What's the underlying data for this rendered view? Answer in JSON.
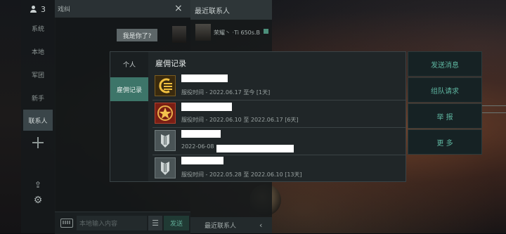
{
  "sidebar": {
    "online_count": "3",
    "items": [
      {
        "label": "系统"
      },
      {
        "label": "本地"
      },
      {
        "label": "军团"
      },
      {
        "label": "新手"
      },
      {
        "label": "联系人"
      }
    ]
  },
  "chat": {
    "title": "戏纠",
    "close_icon": "×",
    "message": "我是你了?",
    "input_placeholder": "本地输入内容",
    "send_label": "发送"
  },
  "recent_contacts": {
    "title": "最近联系人",
    "contact_name": "荣耀丶 ·Ti 650s.B",
    "footer_label": "最近联系人",
    "footer_arrow": "‹"
  },
  "modal": {
    "tabs": [
      {
        "label": "个人"
      },
      {
        "label": "雇佣记录"
      }
    ],
    "title": "雇佣记录",
    "records": [
      {
        "icon": "yellow-corp-icon",
        "detail": "服役时间 - 2022.06.17 至今 [1天]"
      },
      {
        "icon": "red-star-corp-icon",
        "detail": "服役时间 - 2022.06.10 至 2022.06.17 [6天]"
      },
      {
        "icon": "grey-shield-corp-icon",
        "detail": "2022-06-08"
      },
      {
        "icon": "grey-shield-corp-icon",
        "detail": "服役时间 - 2022.05.28 至 2022.06.10 [13天]"
      }
    ]
  },
  "actions": [
    {
      "label": "发送消息"
    },
    {
      "label": "组队请求"
    },
    {
      "label": "举 报"
    },
    {
      "label": "更 多"
    }
  ],
  "colors": {
    "accent": "#5eb5a0",
    "tab_active": "#3d7569",
    "modal_bg": "#202628"
  }
}
